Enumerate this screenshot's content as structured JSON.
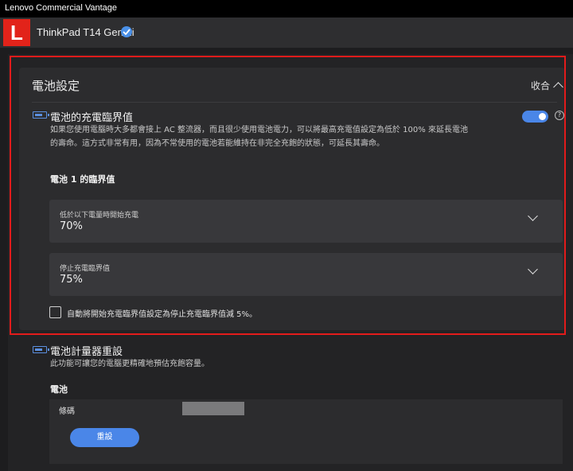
{
  "app": {
    "window_title": "Lenovo Commercial Vantage",
    "logo_letter": "L"
  },
  "device": {
    "name": "ThinkPad T14 Gen 2i"
  },
  "battery_settings": {
    "title": "電池設定",
    "collapse_label": "收合",
    "charge_threshold": {
      "title": "電池的充電臨界值",
      "description_line1": "如果您使用電腦時大多都會接上 AC 整流器，而且很少使用電池電力，可以將最高充電值設定為低於 100% 來延長電池",
      "description_line2": "的壽命。這方式非常有用，因為不常使用的電池若能維持在非完全充飽的狀態，可延長其壽命。",
      "enabled": true,
      "help_symbol": "?",
      "battery1_title": "電池 1 的臨界值",
      "start_label": "低於以下電量時開始充電",
      "start_value": "70%",
      "stop_label": "停止充電臨界值",
      "stop_value": "75%",
      "auto_label": "自動將開始充電臨界值設定為停止充電臨界值減 5%。",
      "auto_checked": false
    }
  },
  "gauge_reset": {
    "title": "電池計量器重設",
    "description": "此功能可讓您的電腦更精確地預估充飽容量。",
    "battery_label": "電池",
    "serial_label": "條碼",
    "reset_label": "重設"
  }
}
